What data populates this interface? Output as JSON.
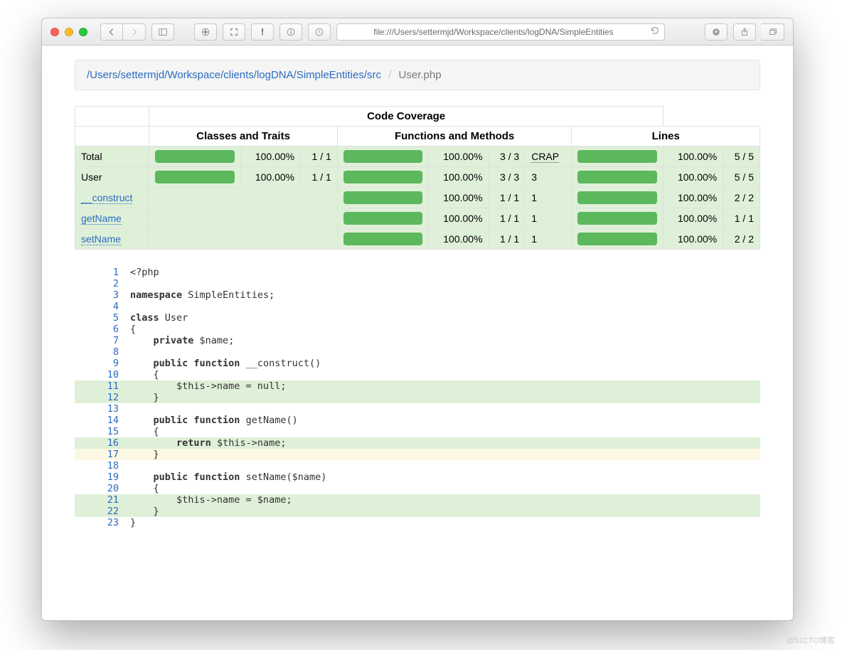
{
  "browser": {
    "url": "file:///Users/settermjd/Workspace/clients/logDNA/SimpleEntities"
  },
  "breadcrumb": {
    "path": "/Users/settermjd/Workspace/clients/logDNA/SimpleEntities/src",
    "file": "User.php"
  },
  "table": {
    "title": "Code Coverage",
    "cols": {
      "c1": "Classes and Traits",
      "c2": "Functions and Methods",
      "c3": "Lines"
    },
    "crap_label": "CRAP",
    "rows": [
      {
        "name": "Total",
        "link": false,
        "indent": false,
        "c1_pct": "100.00%",
        "c1_rat": "1 / 1",
        "c2_pct": "100.00%",
        "c2_rat": "3 / 3",
        "crap": "",
        "show_crap_label": true,
        "c3_pct": "100.00%",
        "c3_rat": "5 / 5",
        "show_c1": true
      },
      {
        "name": "User",
        "link": false,
        "indent": false,
        "c1_pct": "100.00%",
        "c1_rat": "1 / 1",
        "c2_pct": "100.00%",
        "c2_rat": "3 / 3",
        "crap": "3",
        "show_crap_label": false,
        "c3_pct": "100.00%",
        "c3_rat": "5 / 5",
        "show_c1": true
      },
      {
        "name": "__construct",
        "link": true,
        "indent": true,
        "c2_pct": "100.00%",
        "c2_rat": "1 / 1",
        "crap": "1",
        "c3_pct": "100.00%",
        "c3_rat": "2 / 2",
        "show_c1": false
      },
      {
        "name": "getName",
        "link": true,
        "indent": true,
        "c2_pct": "100.00%",
        "c2_rat": "1 / 1",
        "crap": "1",
        "c3_pct": "100.00%",
        "c3_rat": "1 / 1",
        "show_c1": false
      },
      {
        "name": "setName",
        "link": true,
        "indent": true,
        "c2_pct": "100.00%",
        "c2_rat": "1 / 1",
        "crap": "1",
        "c3_pct": "100.00%",
        "c3_rat": "2 / 2",
        "show_c1": false
      }
    ]
  },
  "source": [
    {
      "n": 1,
      "cls": "",
      "html": "&lt;?php"
    },
    {
      "n": 2,
      "cls": "",
      "html": ""
    },
    {
      "n": 3,
      "cls": "",
      "html": "<span class='kw'>namespace</span> SimpleEntities;"
    },
    {
      "n": 4,
      "cls": "",
      "html": ""
    },
    {
      "n": 5,
      "cls": "",
      "html": "<span class='kw'>class</span> User"
    },
    {
      "n": 6,
      "cls": "",
      "html": "{"
    },
    {
      "n": 7,
      "cls": "",
      "html": "    <span class='kw'>private</span> $name;"
    },
    {
      "n": 8,
      "cls": "",
      "html": ""
    },
    {
      "n": 9,
      "cls": "",
      "html": "    <span class='kw'>public function</span> __construct()"
    },
    {
      "n": 10,
      "cls": "",
      "html": "    {"
    },
    {
      "n": 11,
      "cls": "cov",
      "html": "        $this-&gt;name = null;"
    },
    {
      "n": 12,
      "cls": "cov",
      "html": "    }"
    },
    {
      "n": 13,
      "cls": "",
      "html": ""
    },
    {
      "n": 14,
      "cls": "",
      "html": "    <span class='kw'>public function</span> getName()"
    },
    {
      "n": 15,
      "cls": "",
      "html": "    {"
    },
    {
      "n": 16,
      "cls": "cov",
      "html": "        <span class='kw'>return</span> $this-&gt;name;"
    },
    {
      "n": 17,
      "cls": "warn",
      "html": "    }"
    },
    {
      "n": 18,
      "cls": "",
      "html": ""
    },
    {
      "n": 19,
      "cls": "",
      "html": "    <span class='kw'>public function</span> setName($name)"
    },
    {
      "n": 20,
      "cls": "",
      "html": "    {"
    },
    {
      "n": 21,
      "cls": "cov",
      "html": "        $this-&gt;name = $name;"
    },
    {
      "n": 22,
      "cls": "cov",
      "html": "    }"
    },
    {
      "n": 23,
      "cls": "",
      "html": "}"
    }
  ],
  "watermark": "@51CTO博客"
}
